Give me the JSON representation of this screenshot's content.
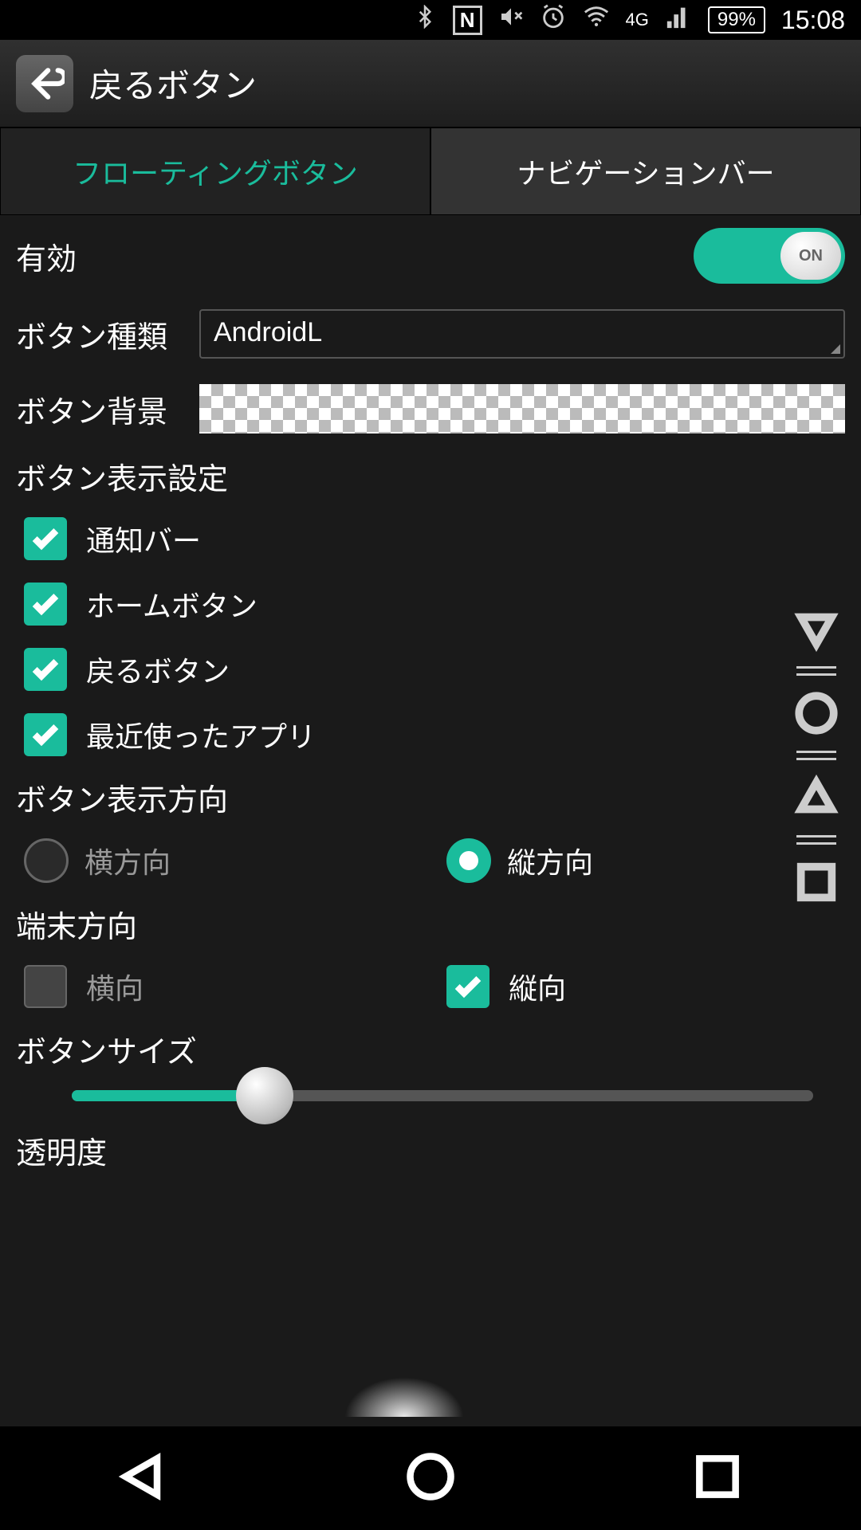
{
  "statusbar": {
    "network": "4G",
    "battery": "99%",
    "time": "15:08"
  },
  "header": {
    "title": "戻るボタン"
  },
  "tabs": {
    "floating": "フローティングボタン",
    "navbar": "ナビゲーションバー"
  },
  "settings": {
    "enabled_label": "有効",
    "toggle_text": "ON",
    "button_type_label": "ボタン種類",
    "button_type_value": "AndroidL",
    "button_bg_label": "ボタン背景",
    "display_settings_label": "ボタン表示設定",
    "checks": {
      "notify": "通知バー",
      "home": "ホームボタン",
      "back": "戻るボタン",
      "recent": "最近使ったアプリ"
    },
    "direction_label": "ボタン表示方向",
    "direction_h": "横方向",
    "direction_v": "縦方向",
    "device_dir_label": "端末方向",
    "device_h": "横向",
    "device_v": "縦向",
    "size_label": "ボタンサイズ",
    "size_percent": 26,
    "transparency_label": "透明度"
  }
}
